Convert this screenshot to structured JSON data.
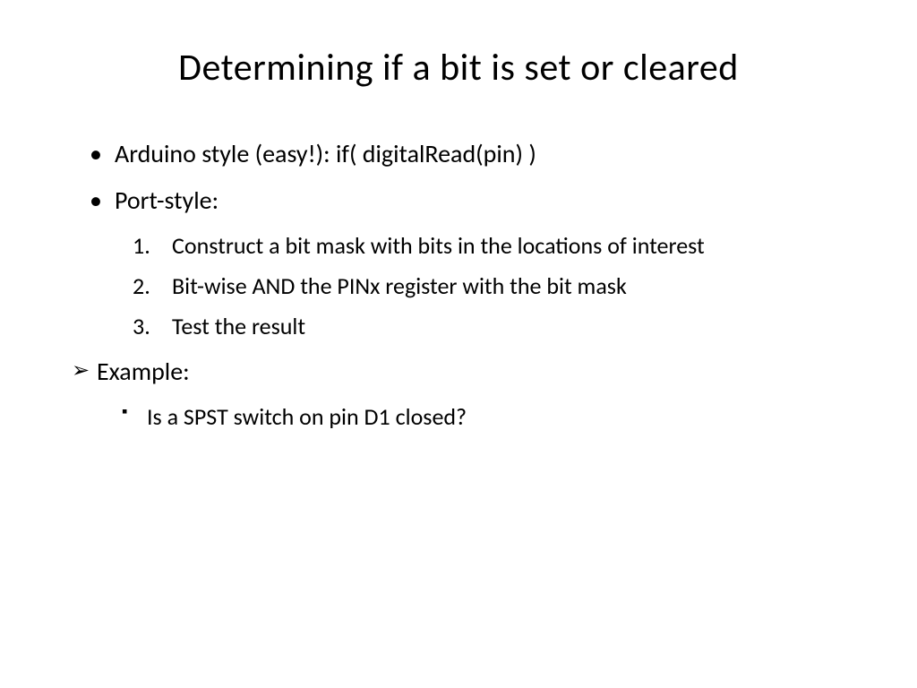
{
  "title": "Determining if a bit is set or cleared",
  "bullets": {
    "item1": "Arduino style (easy!): if( digitalRead(pin) )",
    "item2": "Port-style:",
    "numbered": {
      "n1": "Construct a bit mask with bits in the locations of interest",
      "n2": "Bit-wise AND the PINx register with the bit mask",
      "n3": "Test the result"
    },
    "item3": "Example:",
    "sub": {
      "s1": "Is a SPST switch on pin D1 closed?"
    }
  }
}
